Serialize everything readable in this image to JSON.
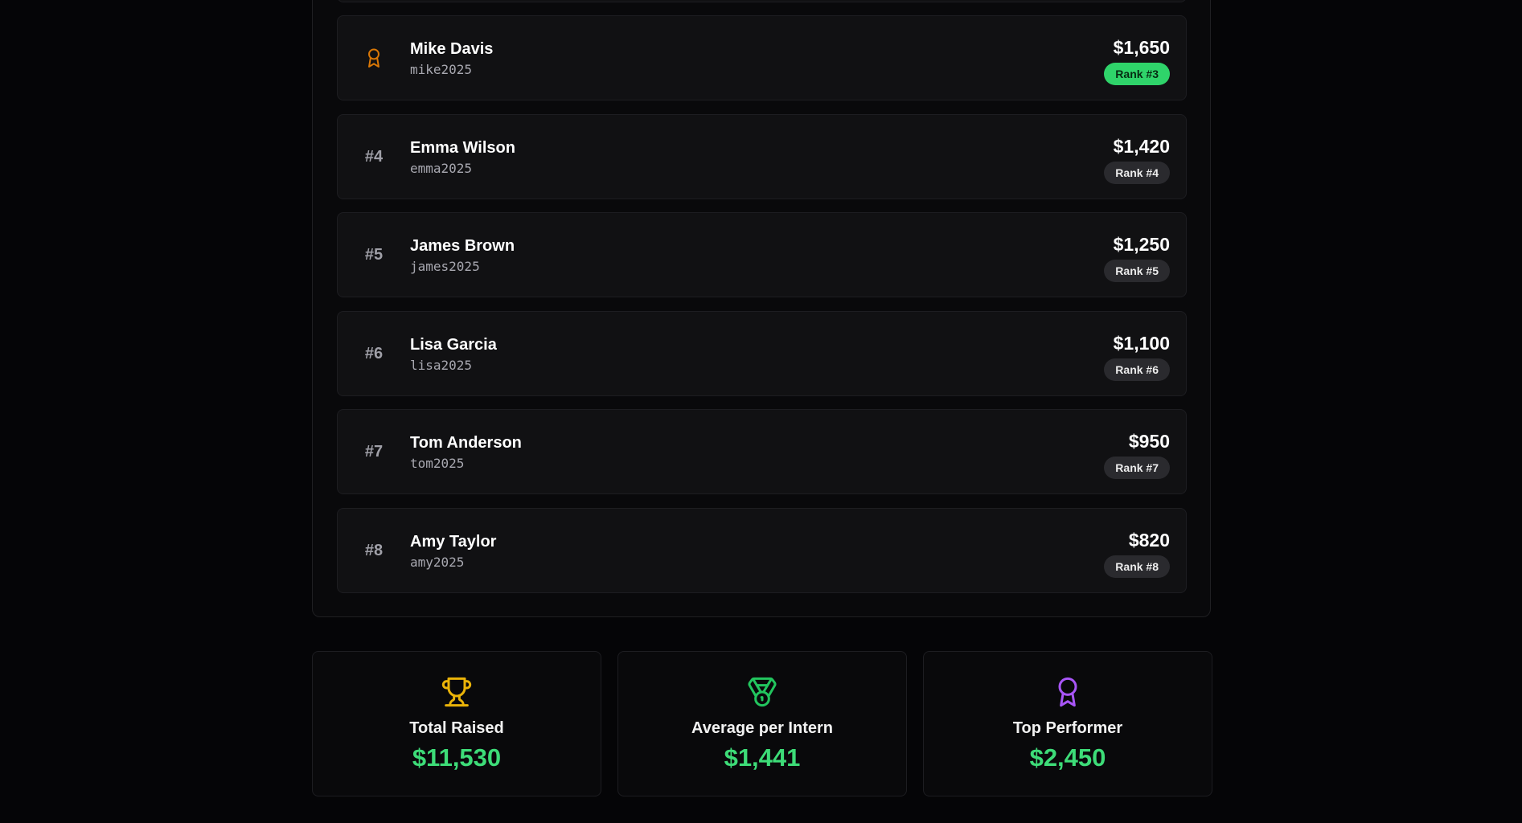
{
  "leaderboard": [
    {
      "rank_label": "",
      "icon": "award-icon",
      "name": "Mike Davis",
      "username": "mike2025",
      "amount": "$1,650",
      "badge": "Rank #3",
      "highlight": true
    },
    {
      "rank_label": "#4",
      "name": "Emma Wilson",
      "username": "emma2025",
      "amount": "$1,420",
      "badge": "Rank #4",
      "highlight": false
    },
    {
      "rank_label": "#5",
      "name": "James Brown",
      "username": "james2025",
      "amount": "$1,250",
      "badge": "Rank #5",
      "highlight": false
    },
    {
      "rank_label": "#6",
      "name": "Lisa Garcia",
      "username": "lisa2025",
      "amount": "$1,100",
      "badge": "Rank #6",
      "highlight": false
    },
    {
      "rank_label": "#7",
      "name": "Tom Anderson",
      "username": "tom2025",
      "amount": "$950",
      "badge": "Rank #7",
      "highlight": false
    },
    {
      "rank_label": "#8",
      "name": "Amy Taylor",
      "username": "amy2025",
      "amount": "$820",
      "badge": "Rank #8",
      "highlight": false
    }
  ],
  "stats": [
    {
      "icon": "trophy-icon",
      "label": "Total Raised",
      "value": "$11,530",
      "icon_color": "#eab308"
    },
    {
      "icon": "medal-icon",
      "label": "Average per Intern",
      "value": "$1,441",
      "icon_color": "#22c55e"
    },
    {
      "icon": "award-icon",
      "label": "Top Performer",
      "value": "$2,450",
      "icon_color": "#a855f7"
    }
  ],
  "colors": {
    "accent_green": "#3ddc78",
    "badge_highlight": "#2fd46a",
    "rank3_icon": "#d97706",
    "background": "#050507"
  }
}
